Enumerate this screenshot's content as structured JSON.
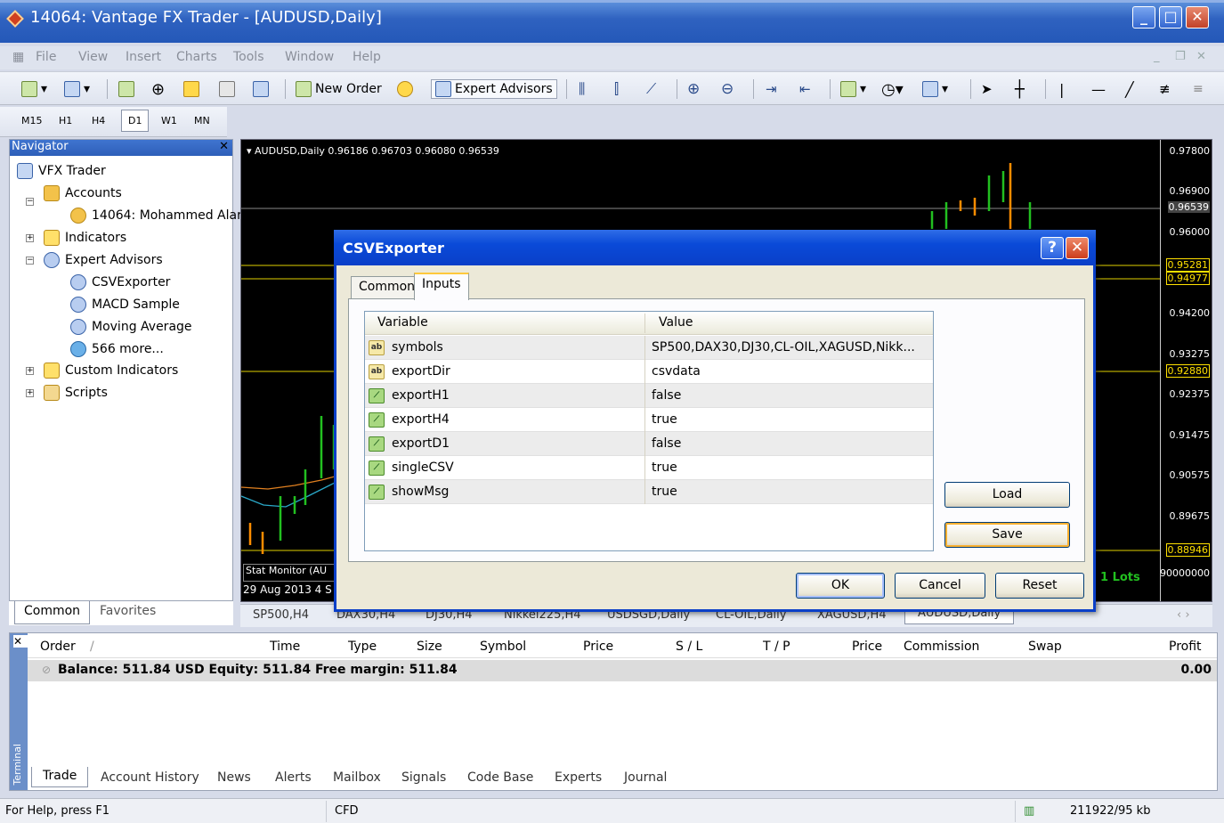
{
  "window": {
    "title": "14064: Vantage FX Trader - [AUDUSD,Daily]"
  },
  "menu": [
    "File",
    "View",
    "Insert",
    "Charts",
    "Tools",
    "Window",
    "Help"
  ],
  "toolbar": {
    "new_order": "New Order",
    "expert_advisors": "Expert Advisors"
  },
  "periods": [
    "M15",
    "H1",
    "H4",
    "D1",
    "W1",
    "MN"
  ],
  "navigator": {
    "title": "Navigator",
    "items": [
      {
        "label": "VFX Trader"
      },
      {
        "label": "Accounts"
      },
      {
        "label": "14064: Mohammed Alar"
      },
      {
        "label": "Indicators"
      },
      {
        "label": "Expert Advisors"
      },
      {
        "label": "CSVExporter"
      },
      {
        "label": "MACD Sample"
      },
      {
        "label": "Moving Average"
      },
      {
        "label": "566 more..."
      },
      {
        "label": "Custom Indicators"
      },
      {
        "label": "Scripts"
      }
    ],
    "tabs": [
      "Common",
      "Favorites"
    ]
  },
  "chart": {
    "header": "AUDUSD,Daily  0.96186 0.96703 0.96080 0.96539",
    "prices": [
      "0.97800",
      "0.96900",
      "0.96539",
      "0.96000",
      "0.95281",
      "0.94977",
      "0.94200",
      "0.93275",
      "0.92880",
      "0.92375",
      "0.91475",
      "0.90575",
      "0.89675",
      "0.88946",
      "90000000"
    ],
    "stat_monitor": "Stat Monitor (AU",
    "date": "29 Aug 2013   4 S",
    "lots": "1 Lots",
    "tabs": [
      "SP500,H4",
      "DAX30,H4",
      "DJ30,H4",
      "Nikkei225,H4",
      "USDSGD,Daily",
      "CL-OIL,Daily",
      "XAGUSD,H4",
      "AUDUSD,Daily"
    ]
  },
  "dialog": {
    "title": "CSVExporter",
    "tabs": [
      "Common",
      "Inputs"
    ],
    "columns": [
      "Variable",
      "Value"
    ],
    "rows": [
      {
        "var": "symbols",
        "val": "SP500,DAX30,DJ30,CL-OIL,XAGUSD,Nikk...",
        "icon": "ab"
      },
      {
        "var": "exportDir",
        "val": "csvdata",
        "icon": "ab"
      },
      {
        "var": "exportH1",
        "val": "false",
        "icon": "bool"
      },
      {
        "var": "exportH4",
        "val": "true",
        "icon": "bool"
      },
      {
        "var": "exportD1",
        "val": "false",
        "icon": "bool"
      },
      {
        "var": "singleCSV",
        "val": "true",
        "icon": "bool"
      },
      {
        "var": "showMsg",
        "val": "true",
        "icon": "bool"
      }
    ],
    "icon_text": "ab",
    "load": "Load",
    "save": "Save",
    "ok": "OK",
    "cancel": "Cancel",
    "reset": "Reset"
  },
  "terminal": {
    "side_label": "Terminal",
    "columns": [
      "Order",
      "/",
      "Time",
      "Type",
      "Size",
      "Symbol",
      "Price",
      "S / L",
      "T / P",
      "Price",
      "Commission",
      "Swap",
      "Profit"
    ],
    "balance": "Balance: 511.84 USD  Equity: 511.84  Free margin: 511.84",
    "profit": "0.00",
    "tabs": [
      "Trade",
      "Account History",
      "News",
      "Alerts",
      "Mailbox",
      "Signals",
      "Code Base",
      "Experts",
      "Journal"
    ]
  },
  "status": {
    "help": "For Help, press F1",
    "profile": "CFD",
    "traffic": "211922/95 kb"
  },
  "colors": {
    "chart_bg": "#000000",
    "bull": "#22c020",
    "bear": "#ff8c00",
    "level": "#ffe000",
    "dialog_title": "#0a3fc8"
  }
}
